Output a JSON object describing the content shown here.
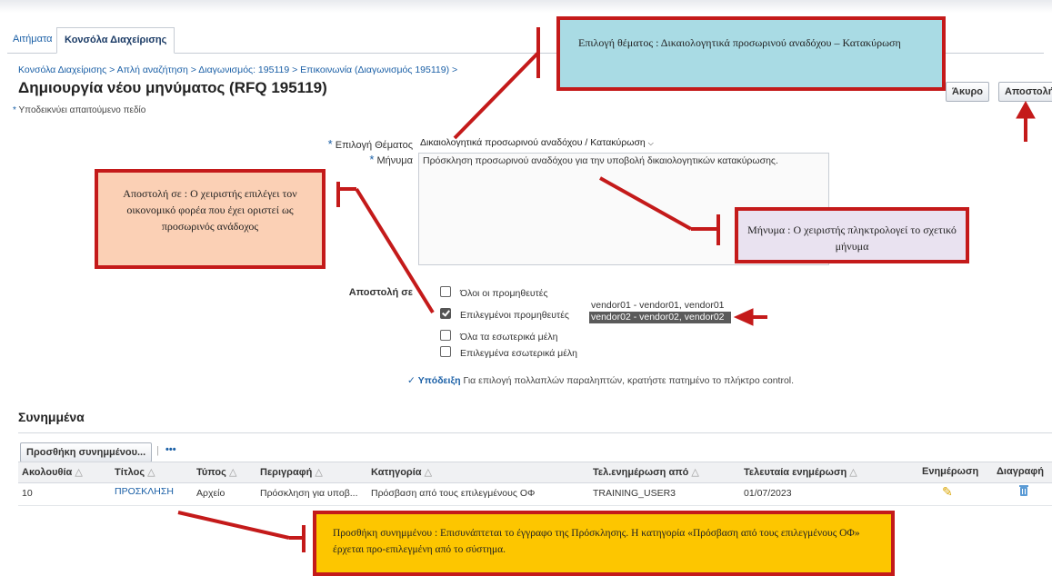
{
  "tabs": [
    {
      "label": "Αιτήματα",
      "active": false
    },
    {
      "label": "Κονσόλα Διαχείρισης",
      "active": true
    }
  ],
  "breadcrumb": "Κονσόλα Διαχείρισης  >  Απλή αναζήτηση  >  Διαγωνισμός: 195119  >  Επικοινωνία (Διαγωνισμός 195119)  >",
  "page_title": "Δημιουργία νέου μηνύματος (RFQ 195119)",
  "required_note": "Υποδεικνύει απαιτούμενο πεδίο",
  "buttons": {
    "cancel": "Άκυρο",
    "send": "Αποστολή"
  },
  "form": {
    "subject_label": "Επιλογή Θέματος",
    "subject_value": "Δικαιολογητικά προσωρινού αναδόχου / Κατακύρωση",
    "message_label": "Μήνυμα",
    "message_value": "Πρόσκληση προσωρινού αναδόχου για την υποβολή δικαιολογητικών κατακύρωσης.",
    "send_to_label": "Αποστολή σε",
    "options": [
      {
        "label": "Όλοι οι προμηθευτές",
        "checked": false
      },
      {
        "label": "Επιλεγμένοι προμηθευτές",
        "checked": true
      },
      {
        "label": "Όλα τα εσωτερικά μέλη",
        "checked": false
      },
      {
        "label": "Επιλεγμένα εσωτερικά μέλη",
        "checked": false
      }
    ],
    "vendors": [
      {
        "label": "vendor01 - vendor01, vendor01",
        "selected": false
      },
      {
        "label": "vendor02 - vendor02, vendor02",
        "selected": true
      }
    ],
    "hint_label": "Υπόδειξη",
    "hint_text": "Για επιλογή πολλαπλών παραληπτών, κρατήστε πατημένο το πλήκτρο control."
  },
  "attachments": {
    "title": "Συνημμένα",
    "add_button": "Προσθήκη συνημμένου...",
    "more": "•••",
    "columns": [
      "Ακολουθία",
      "Τίτλος",
      "Τύπος",
      "Περιγραφή",
      "Κατηγορία",
      "Τελ.ενημέρωση από",
      "Τελευταία ενημέρωση",
      "Ενημέρωση",
      "Διαγραφή"
    ],
    "rows": [
      {
        "seq": "10",
        "title": "ΠΡΟΣΚΛΗΣΗ",
        "type": "Αρχείο",
        "description": "Πρόσκληση για υποβ...",
        "category": "Πρόσβαση από τους επιλεγμένους ΟΦ",
        "updated_by": "TRAINING_USER3",
        "last_update": "01/07/2023"
      }
    ]
  },
  "annotations": {
    "subject": "Επιλογή θέματος : Δικαιολογητικά προσωρινού αναδόχου – Κατακύρωση",
    "send_to": "Αποστολή σε : Ο χειριστής επιλέγει τον οικονομικό φορέα που έχει οριστεί ως προσωρινός ανάδοχος",
    "message": "Μήνυμα : Ο χειριστής πληκτρολογεί το σχετικό μήνυμα",
    "attachment": "Προσθήκη συνημμένου : Επισυνάπτεται το έγγραφο της Πρόσκλησης. Η κατηγορία «Πρόσβαση από τους επιλεγμένους ΟΦ» έρχεται προ-επιλεγμένη από το σύστημα."
  },
  "colors": {
    "annotation_border": "#c41a1a",
    "link": "#1a5fa6",
    "note_blue": "#a9dbe4",
    "note_orange": "#fbd0b5",
    "note_lilac": "#e9e2f0",
    "note_yellow": "#fdc600"
  }
}
